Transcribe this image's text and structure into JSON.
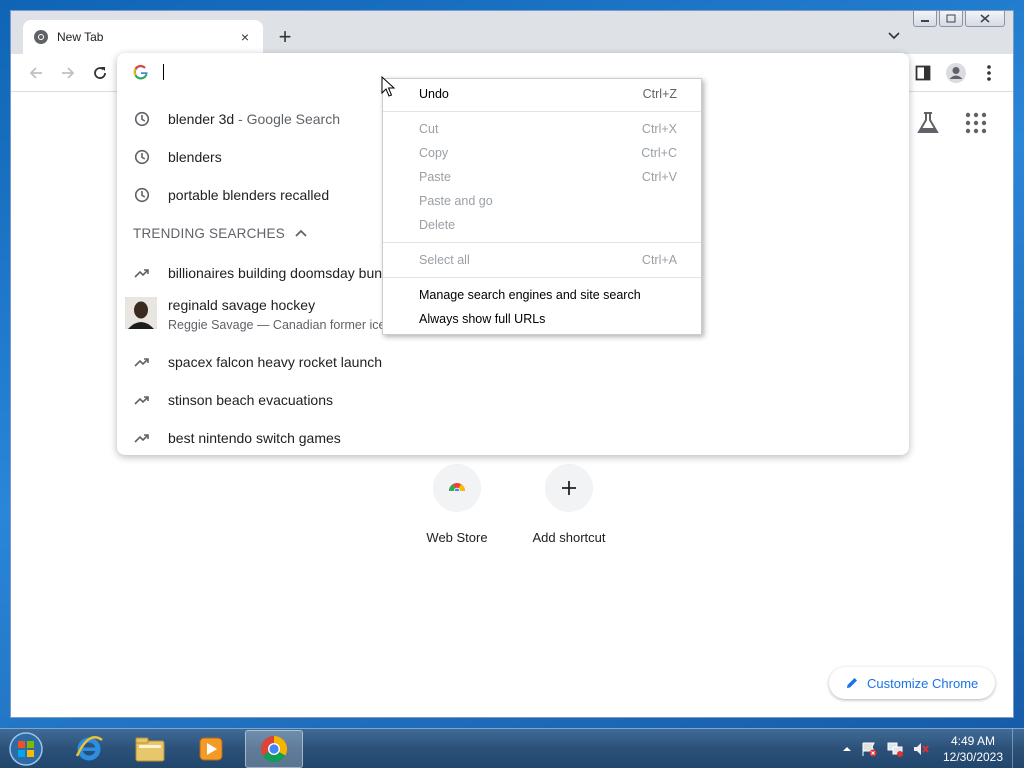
{
  "browser": {
    "tab_title": "New Tab",
    "new_tab_symbol": "+",
    "tab_close_symbol": "×"
  },
  "omnibox": {
    "input_value": "",
    "history": [
      {
        "text": "blender 3d",
        "sub": " - Google Search"
      },
      {
        "text": "blenders",
        "sub": ""
      },
      {
        "text": "portable blenders recalled",
        "sub": ""
      }
    ],
    "trending_header": "TRENDING SEARCHES",
    "trending": [
      {
        "text": "billionaires building doomsday bun"
      },
      {
        "text": "reginald savage hockey",
        "sub": "Reggie Savage — Canadian former ice"
      },
      {
        "text": "spacex falcon heavy rocket launch"
      },
      {
        "text": "stinson beach evacuations"
      },
      {
        "text": "best nintendo switch games"
      }
    ]
  },
  "context_menu": {
    "undo": {
      "label": "Undo",
      "key": "Ctrl+Z"
    },
    "cut": {
      "label": "Cut",
      "key": "Ctrl+X"
    },
    "copy": {
      "label": "Copy",
      "key": "Ctrl+C"
    },
    "paste": {
      "label": "Paste",
      "key": "Ctrl+V"
    },
    "paste_go": {
      "label": "Paste and go",
      "key": ""
    },
    "delete": {
      "label": "Delete",
      "key": ""
    },
    "select_all": {
      "label": "Select all",
      "key": "Ctrl+A"
    },
    "manage": {
      "label": "Manage search engines and site search"
    },
    "full_urls": {
      "label": "Always show full URLs"
    }
  },
  "ntp": {
    "shortcuts": [
      {
        "label": "Web Store"
      },
      {
        "label": "Add shortcut"
      }
    ],
    "customize_label": "Customize Chrome"
  },
  "taskbar": {
    "time": "4:49 AM",
    "date": "12/30/2023"
  },
  "colors": {
    "accent": "#1a73e8",
    "taskbar": "#2c5179"
  }
}
